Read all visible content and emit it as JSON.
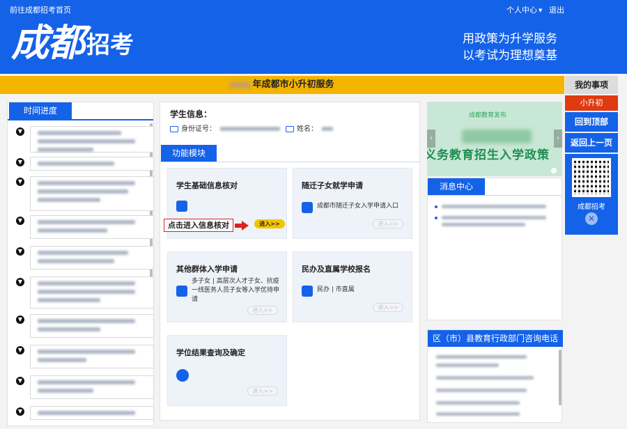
{
  "header": {
    "top_link": "前往成都招考首页",
    "user_menu": "个人中心",
    "logout": "退出",
    "logo_main": "成都",
    "logo_sub": "招考",
    "slogan_line1": "用政策为升学服务",
    "slogan_line2": "以考试为理想奠基",
    "brand_color": "#1462e8"
  },
  "band": {
    "title": "年成都市小升初服务",
    "color": "#f4b400"
  },
  "sidebar": {
    "title": "我的事项",
    "tag": "小升初",
    "back_top": "回到顶部",
    "back_prev": "返回上一页",
    "qr_label": "成都招考",
    "close_icon": "close-icon"
  },
  "timeline": {
    "tab": "时间进度",
    "icon": "arrow-down-icon"
  },
  "student": {
    "title": "学生信息：",
    "id_label": "身份证号：",
    "name_label": "姓名："
  },
  "functions": {
    "tab": "功能模块",
    "enter_label": "进入>>",
    "callout": "点击进入信息核对",
    "cards": [
      {
        "title": "学生基础信息核对",
        "desc": ""
      },
      {
        "title": "随迁子女就学申请",
        "desc": "成都市随迁子女入学申请入口"
      },
      {
        "title": "其他群体入学申请",
        "desc": "多子女 | 高层次人才子女、抗疫一线医务人员子女等入学优待申请"
      },
      {
        "title": "民办及直属学校报名",
        "desc": "民办 | 市直属"
      },
      {
        "title": "学位结果查询及确定",
        "desc": ""
      }
    ]
  },
  "banner": {
    "brand": "成都教育发布",
    "text": "义务教育招生入学政策",
    "prev": "‹",
    "next": "›"
  },
  "news": {
    "tab": "消息中心"
  },
  "contact": {
    "tab": "区（市）县教育行政部门咨询电话"
  }
}
